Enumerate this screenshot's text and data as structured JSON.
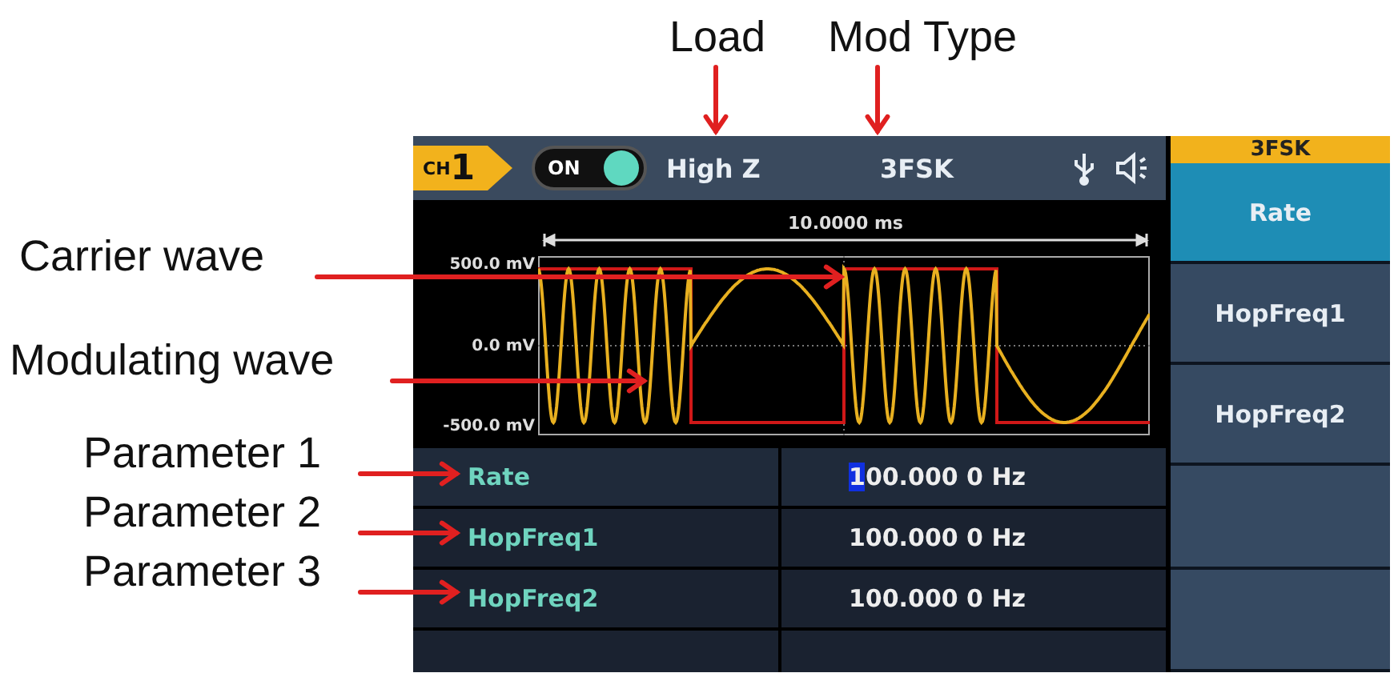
{
  "callouts_top": [
    {
      "text": "Load"
    },
    {
      "text": "Mod Type"
    }
  ],
  "callouts_left": [
    {
      "text": "Carrier wave"
    },
    {
      "text": "Modulating wave"
    },
    {
      "text": "Parameter 1"
    },
    {
      "text": "Parameter 2"
    },
    {
      "text": "Parameter 3"
    }
  ],
  "header": {
    "channel_prefix": "CH",
    "channel_number": "1",
    "output": {
      "label": "ON",
      "on": true
    },
    "load": "High Z",
    "mod_type": "3FSK"
  },
  "plot": {
    "time_span": "10.0000 ms",
    "y_labels": [
      "500.0 mV",
      "0.0 mV",
      "-500.0 mV"
    ]
  },
  "params": [
    {
      "name": "Rate",
      "value": "100.000 0 Hz",
      "selected": true
    },
    {
      "name": "HopFreq1",
      "value": "100.000 0 Hz",
      "selected": false
    },
    {
      "name": "HopFreq2",
      "value": "100.000 0 Hz",
      "selected": false
    }
  ],
  "softkeys": {
    "title": "3FSK",
    "items": [
      {
        "label": "Rate",
        "selected": true
      },
      {
        "label": "HopFreq1",
        "selected": false
      },
      {
        "label": "HopFreq2",
        "selected": false
      }
    ]
  }
}
